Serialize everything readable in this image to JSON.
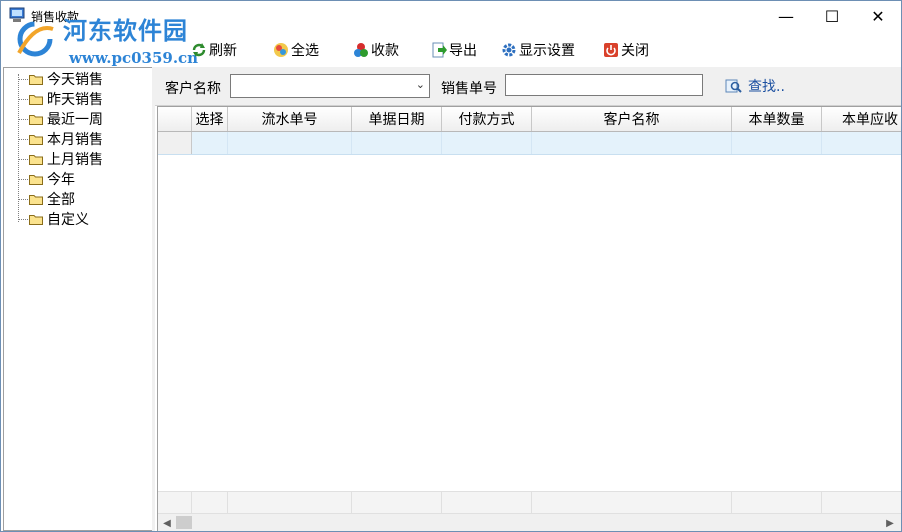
{
  "window": {
    "title": "销售收款",
    "controls": {
      "minimize": "—",
      "maximize": "☐",
      "close": "✕"
    }
  },
  "watermark": {
    "name": "河东软件园",
    "url": "www.pc0359.cn"
  },
  "toolbar": {
    "refresh": "刷新",
    "select_all": "全选",
    "collect": "收款",
    "export": "导出",
    "display_settings": "显示设置",
    "close": "关闭"
  },
  "tree": {
    "items": [
      {
        "label": "今天销售"
      },
      {
        "label": "昨天销售"
      },
      {
        "label": "最近一周"
      },
      {
        "label": "本月销售"
      },
      {
        "label": "上月销售"
      },
      {
        "label": "今年"
      },
      {
        "label": "全部"
      },
      {
        "label": "自定义"
      }
    ]
  },
  "filter": {
    "customer_label": "客户名称",
    "customer_value": "",
    "order_label": "销售单号",
    "order_value": "",
    "find": "查找.."
  },
  "grid": {
    "columns": [
      "选择",
      "流水单号",
      "单据日期",
      "付款方式",
      "客户名称",
      "本单数量",
      "本单应收"
    ]
  },
  "colors": {
    "accent": "#2d84d6",
    "row_highlight": "#e4f2fb",
    "link": "#1b4fa0"
  }
}
